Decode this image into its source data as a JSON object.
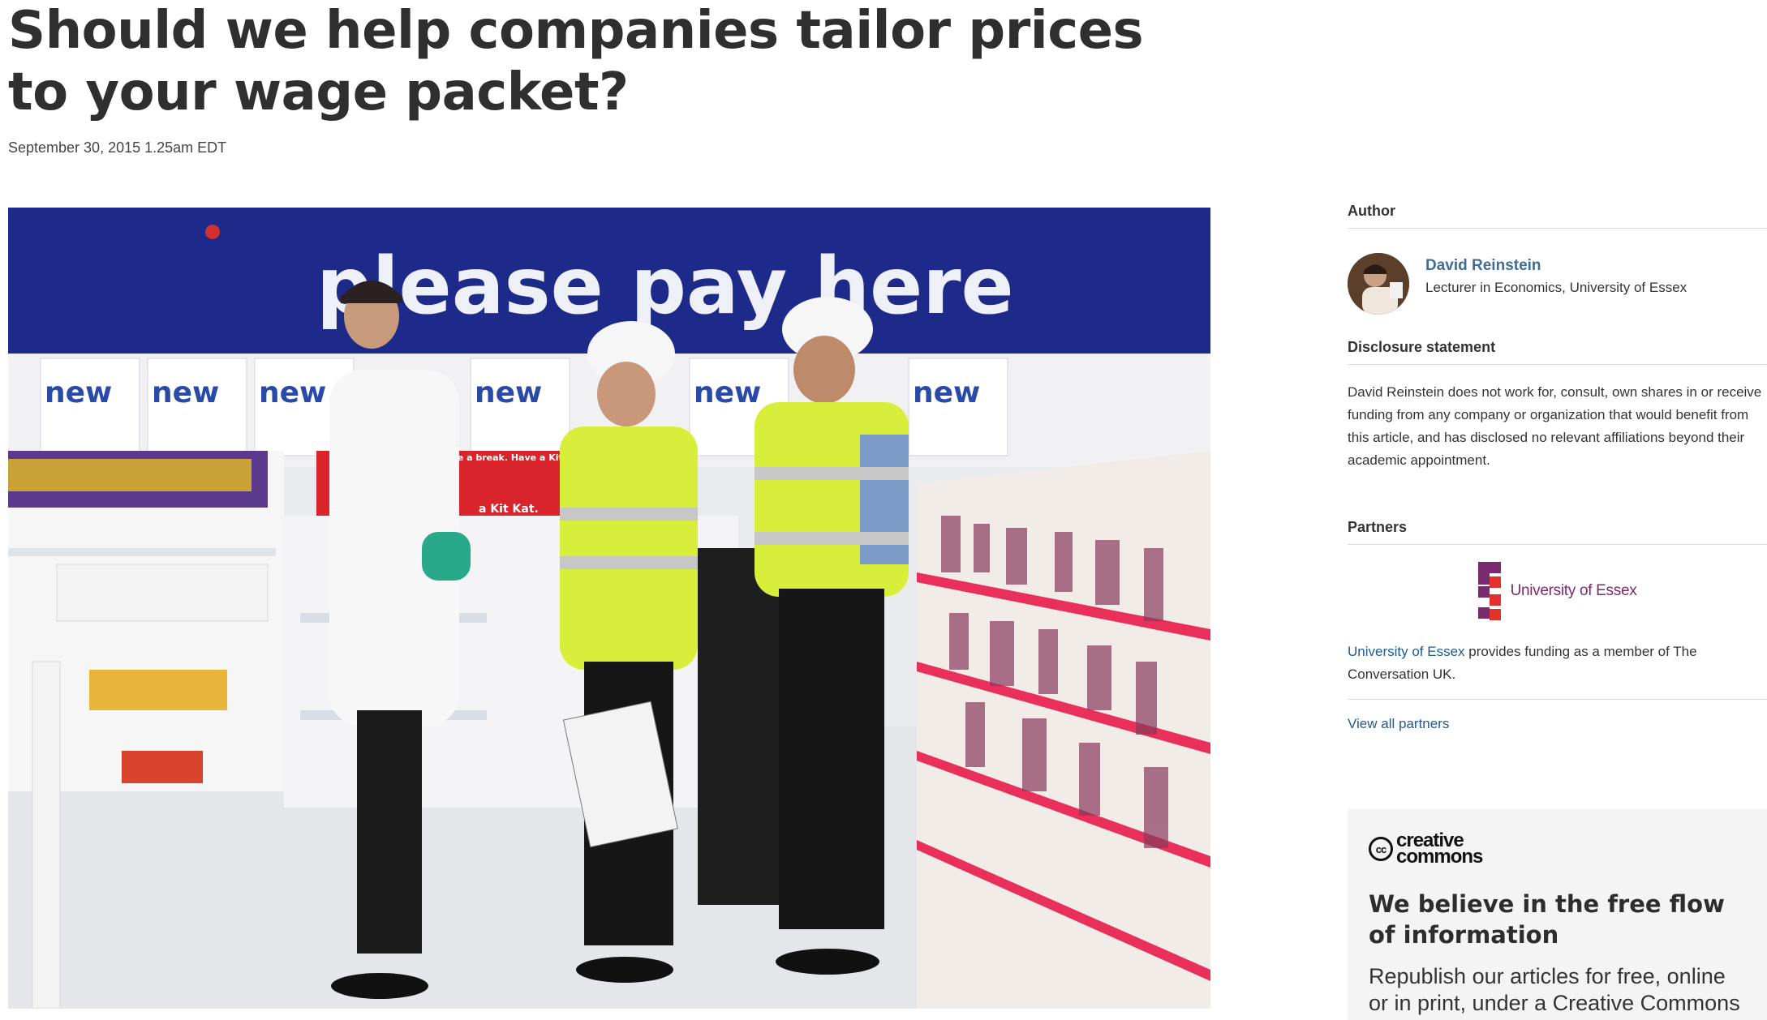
{
  "article": {
    "headline": "Should we help companies tailor prices to your wage packet?",
    "date": "September 30, 2015 1.25am EDT"
  },
  "hero_image": {
    "sign_text": "please pay here",
    "shelf_label": "new",
    "kitkat_text": "Have a break. Have a Kit Kat.",
    "kitkat_short": "a Kit Kat.",
    "colors": {
      "sign_blue": "#1e2a8a",
      "hi_vis": "#d7ef3a",
      "shelf_pink": "#e8305a"
    }
  },
  "sidebar": {
    "author_heading": "Author",
    "author_name": "David Reinstein",
    "author_role": "Lecturer in Economics, University of Essex",
    "disclosure_heading": "Disclosure statement",
    "disclosure_text": "David Reinstein does not work for, consult, own shares in or receive funding from any company or organization that would benefit from this article, and has disclosed no relevant affiliations beyond their academic appointment.",
    "partners_heading": "Partners",
    "partner_logo_text": "University of Essex",
    "partner_link": "University of Essex",
    "partner_text_rest": " provides funding as a member of The Conversation UK.",
    "view_all_partners": "View all partners"
  },
  "cc_box": {
    "logo_cc": "cc",
    "logo_text_line1": "creative",
    "logo_text_line2": "commons",
    "title": "We believe in the free flow of information",
    "body": "Republish our articles for free, online or in print, under a Creative Commons"
  },
  "colors": {
    "link": "#1f5a92",
    "author_link": "#3d6f96",
    "essex_purple": "#7a2a6f",
    "essex_red": "#e2302d"
  }
}
